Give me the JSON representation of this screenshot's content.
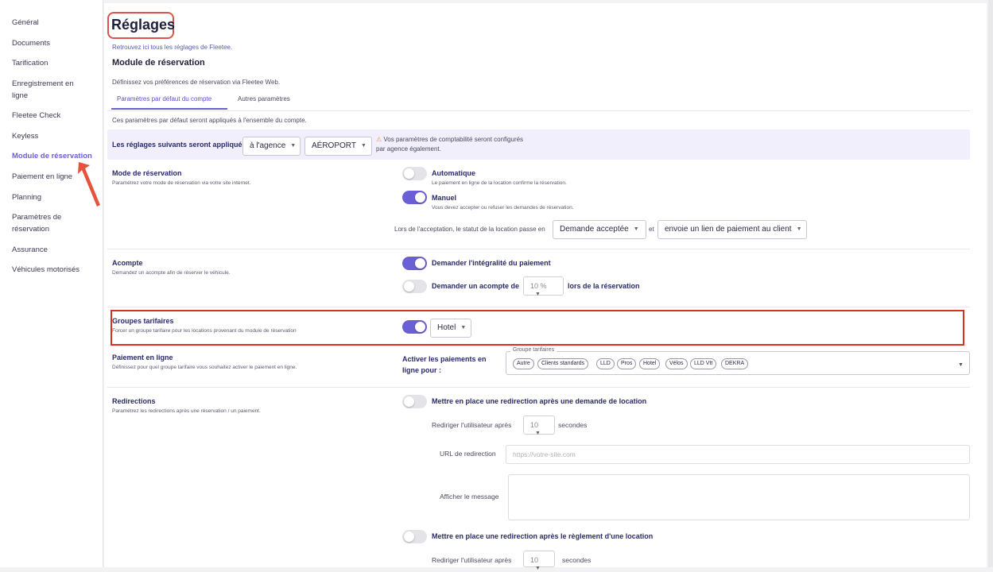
{
  "sidebar": {
    "items": [
      {
        "label": "Général"
      },
      {
        "label": "Documents"
      },
      {
        "label": "Tarification"
      },
      {
        "label": "Enregistrement en ligne"
      },
      {
        "label": "Fleetee Check"
      },
      {
        "label": "Keyless"
      },
      {
        "label": "Module de réservation",
        "active": true
      },
      {
        "label": "Paiement en ligne"
      },
      {
        "label": "Planning"
      },
      {
        "label": "Paramètres de réservation"
      },
      {
        "label": "Assurance"
      },
      {
        "label": "Véhicules motorisés"
      }
    ]
  },
  "header": {
    "title": "Réglages",
    "subtitle": "Retrouvez ici tous les réglages de Fleetee.",
    "module_title": "Module de réservation",
    "module_desc": "Définissez vos préférences de réservation via Fleetee Web."
  },
  "tabs": [
    {
      "label": "Paramètres par défaut du compte",
      "active": true
    },
    {
      "label": "Autres paramètres",
      "active": false
    }
  ],
  "defaults_note": "Ces paramètres par défaut seront appliqués à l'ensemble du compte.",
  "banner": {
    "label": "Les réglages suivants seront appliqués",
    "scope_select": "à l'agence",
    "agency_select": "AÉROPORT",
    "warning": "Vos paramètres de comptabilité seront configurés par agence également."
  },
  "reservation_mode": {
    "title": "Mode de réservation",
    "desc": "Paramétrez votre mode de réservation via votre site internet.",
    "auto_label": "Automatique",
    "auto_desc": "Le paiement en ligne de la location confirme la réservation.",
    "auto_on": false,
    "manual_label": "Manuel",
    "manual_desc": "Vous devez accepter ou refuser les demandes de réservation.",
    "manual_on": true,
    "acceptance_text": "Lors de l'acceptation, le statut de la location passe en",
    "status_select": "Demande acceptée",
    "and_text": "et",
    "action_select": "envoie un lien de paiement au client"
  },
  "deposit": {
    "title": "Acompte",
    "desc": "Demandez un acompte afin de réserver le véhicule.",
    "full_label": "Demander l'intégralité du paiement",
    "full_on": true,
    "partial_label": "Demander un acompte de",
    "partial_on": false,
    "pct_value": "10 %",
    "partial_suffix": "lors de la réservation"
  },
  "rate_groups": {
    "title": "Groupes tarifaires",
    "desc": "Forcer un groupe tarifaire pour les locations provenant du module de réservation",
    "enabled": true,
    "selected": "Hotel"
  },
  "online_payment": {
    "title": "Paiement en ligne",
    "desc": "Définissez pour quel groupe tarifaire vous souhaitez activer le paiement en ligne.",
    "activate_label": "Activer les paiements en ligne pour :",
    "legend": "Groupe tarifaires",
    "chips": [
      "Autre",
      "Clients standards",
      "LLD",
      "Pros",
      "Hotel",
      "Vélos",
      "LLD Vtt",
      "DEKRA"
    ]
  },
  "redirections": {
    "title": "Redirections",
    "desc": "Paramétrez les redirections après une réservation / un paiement.",
    "request_label": "Mettre en place une redirection après une demande de location",
    "request_on": false,
    "redirect_label": "Rediriger l'utilisateur après",
    "redirect_value": "10",
    "seconds": "secondes",
    "url_label": "URL de redirection",
    "url_placeholder": "https://votre-site.com",
    "message_label": "Afficher le message",
    "payment_label": "Mettre en place une redirection après le règlement d'une location",
    "payment_on": false,
    "redirect_value2": "10",
    "seconds2": "secondes"
  }
}
